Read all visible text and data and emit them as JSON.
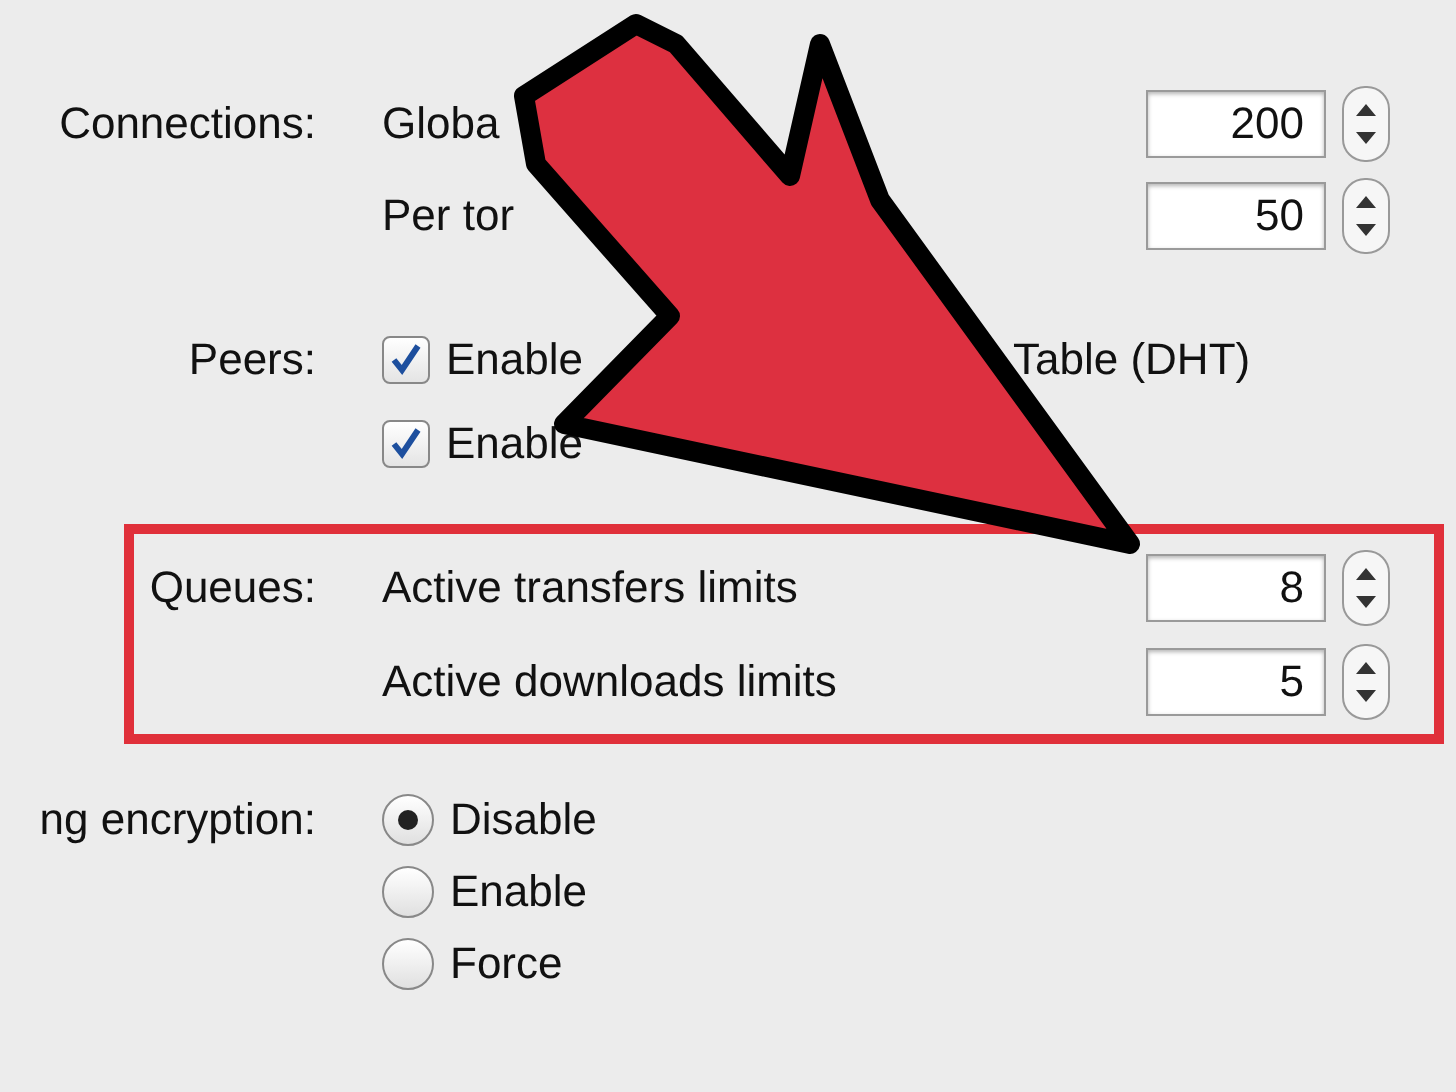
{
  "connections": {
    "label": "Connections:",
    "rows": [
      {
        "label": "Globa",
        "value": "200"
      },
      {
        "label": "Per tor",
        "value": "50"
      }
    ]
  },
  "peers": {
    "label": "Peers:",
    "options": [
      {
        "texts": [
          "Enable",
          "Table (DHT)"
        ],
        "checked": true
      },
      {
        "texts": [
          "Enable"
        ],
        "checked": true
      }
    ]
  },
  "queues": {
    "label": "Queues:",
    "highlighted": true,
    "rows": [
      {
        "label": "Active transfers limits",
        "value": "8"
      },
      {
        "label": "Active downloads limits",
        "value": "5"
      }
    ]
  },
  "encryption": {
    "label": "ng encryption:",
    "options": [
      {
        "label": "Disable",
        "selected": true
      },
      {
        "label": "Enable",
        "selected": false
      },
      {
        "label": "Force",
        "selected": false
      }
    ]
  }
}
